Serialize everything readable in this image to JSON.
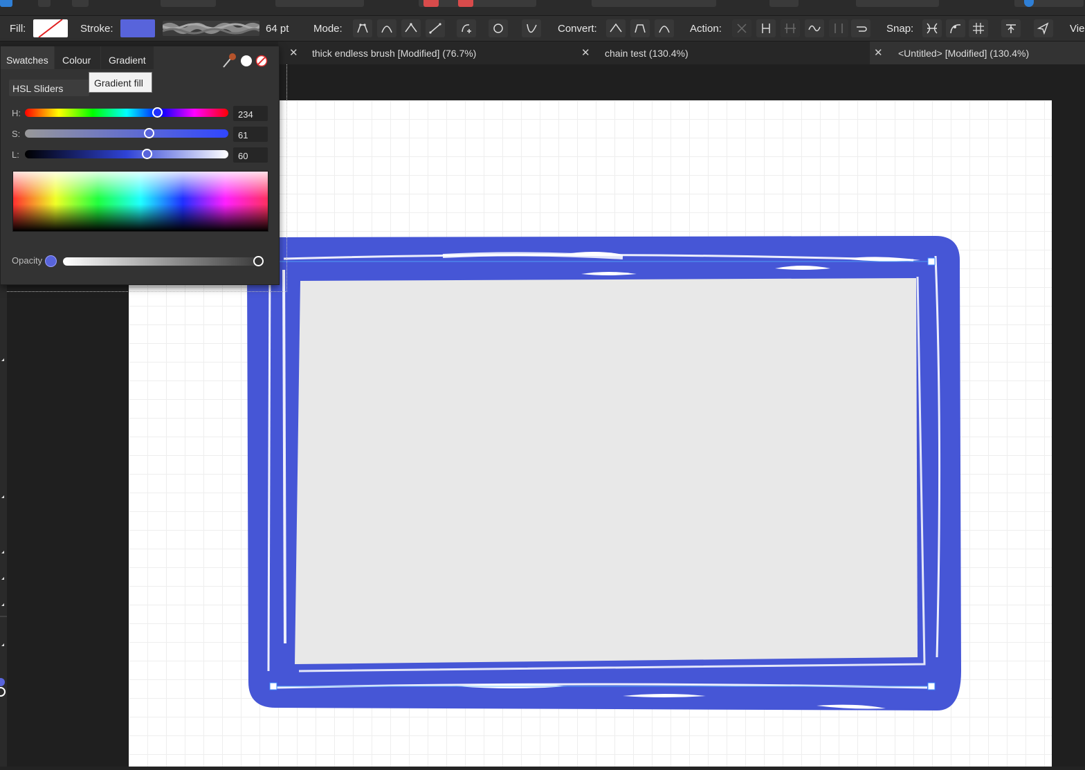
{
  "toolbar": {
    "fill_label": "Fill:",
    "stroke_label": "Stroke:",
    "stroke_width": "64 pt",
    "mode_label": "Mode:",
    "convert_label": "Convert:",
    "action_label": "Action:",
    "snap_label": "Snap:",
    "view_label": "Vie",
    "stroke_color": "#5864db"
  },
  "tabs": [
    {
      "title": "thick endless brush [Modified] (76.7%)"
    },
    {
      "title": "chain test (130.4%)"
    },
    {
      "title": "<Untitled> [Modified] (130.4%)"
    }
  ],
  "colour_panel": {
    "tabs": [
      "Swatches",
      "Colour",
      "Gradient"
    ],
    "tooltip": "Gradient fill",
    "mode": "HSL Sliders",
    "sliders": [
      {
        "label": "H:",
        "value": "234",
        "fraction": 0.65
      },
      {
        "label": "S:",
        "value": "61",
        "fraction": 0.61
      },
      {
        "label": "L:",
        "value": "60",
        "fraction": 0.6
      }
    ],
    "opacity_label": "Opacity",
    "opacity_fraction": 1.0,
    "current_color": "#5864db"
  }
}
